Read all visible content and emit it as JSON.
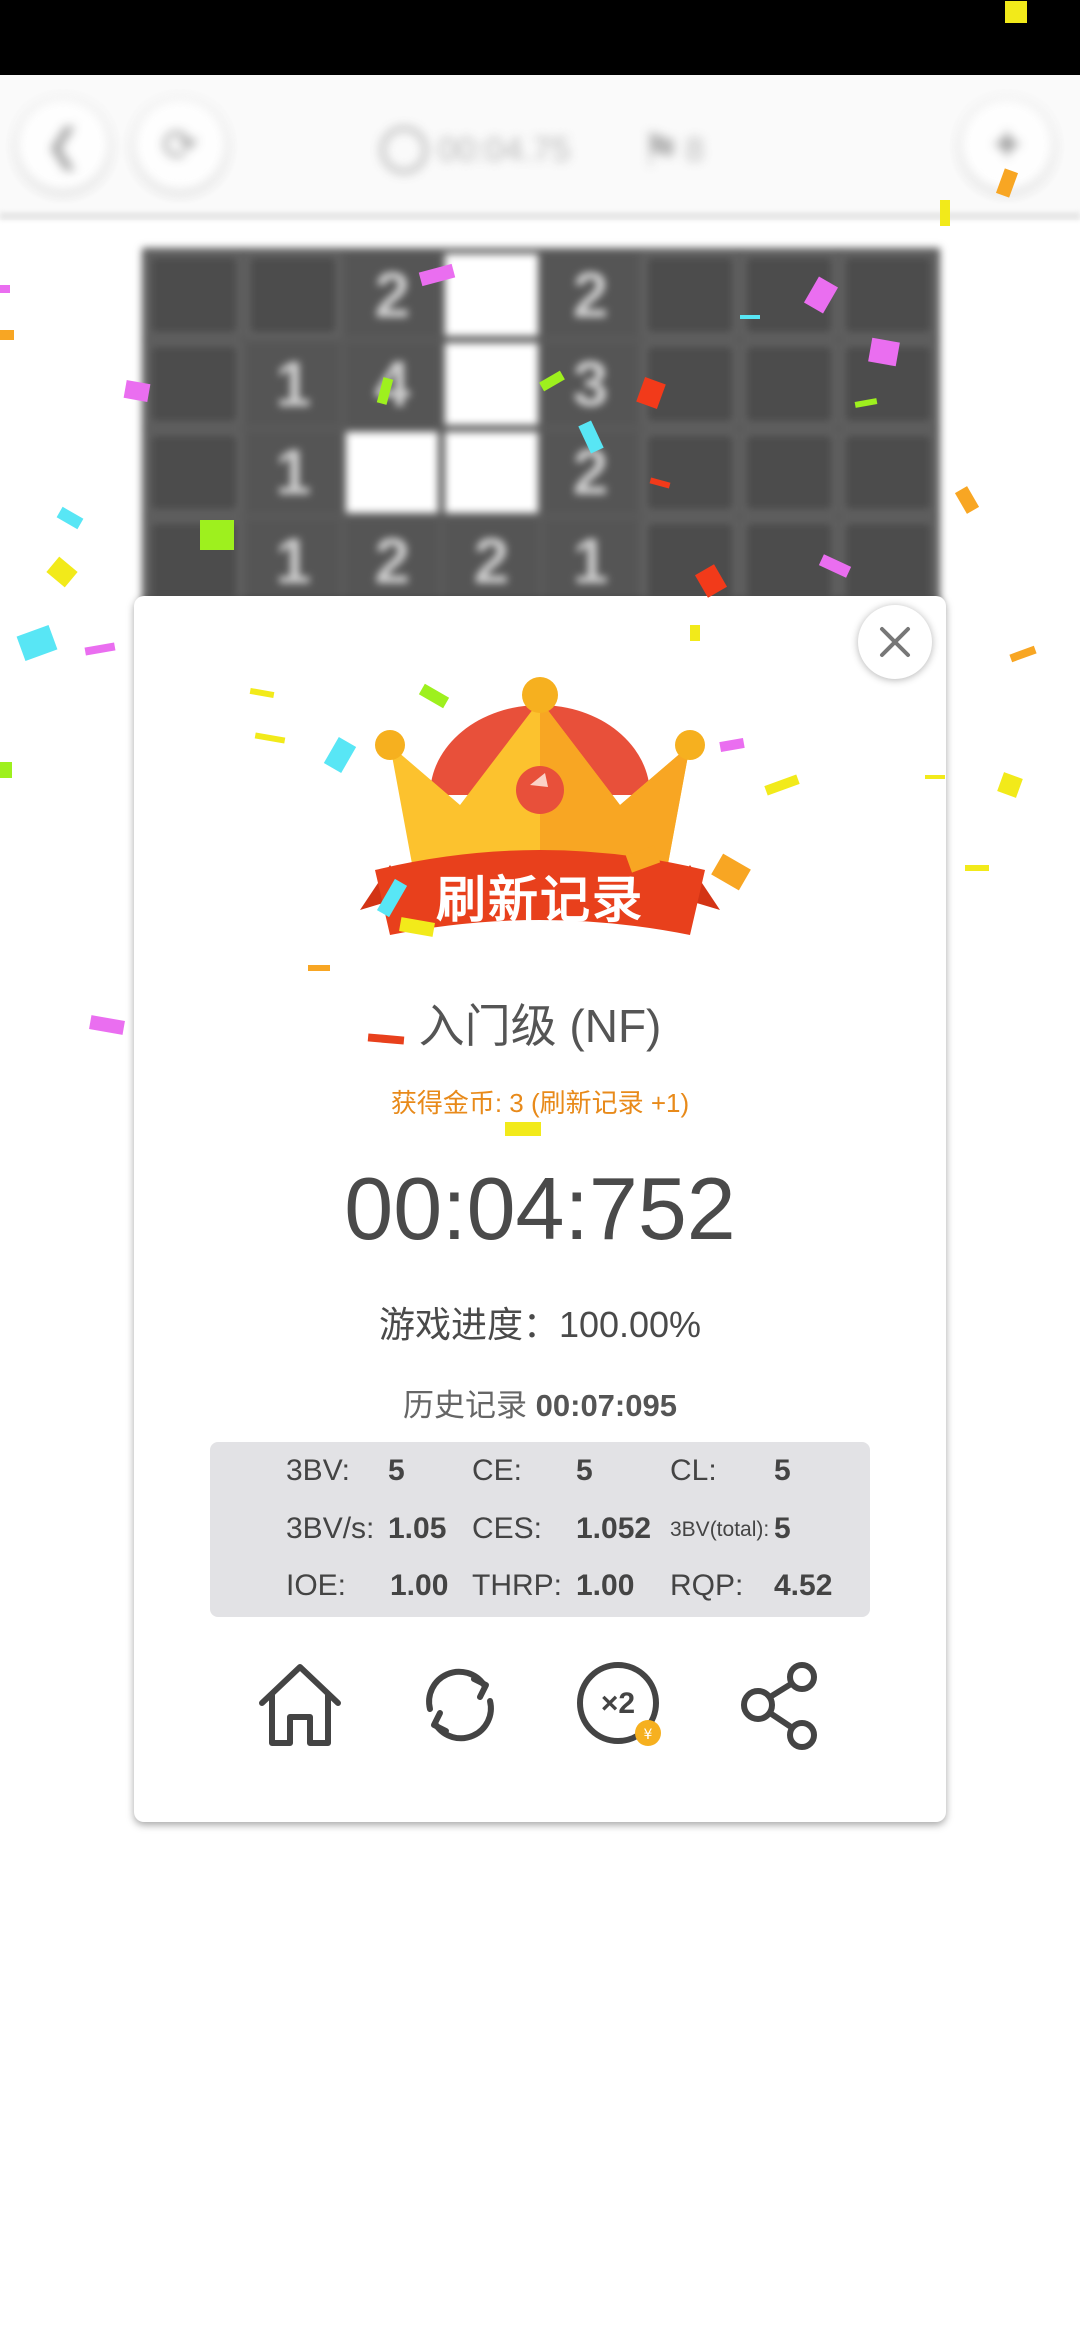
{
  "topbar": {
    "timer": "00:04.75",
    "flags": "8"
  },
  "board": {
    "cells": [
      "",
      "",
      "2",
      "#",
      "2",
      "",
      "",
      "",
      "",
      "1",
      "4",
      "#",
      "3",
      "",
      "",
      "",
      "",
      "1",
      "#",
      "#",
      "2",
      "",
      "",
      "",
      "",
      "1",
      "2",
      "2",
      "1",
      "",
      "",
      ""
    ]
  },
  "dialog": {
    "banner": "刷新记录",
    "level": "入门级 (NF)",
    "coins": "获得金币: 3 (刷新记录 +1)",
    "time": "00:04:752",
    "progress": "游戏进度：100.00%",
    "history_label": "历史记录",
    "history_value": "00:07:095",
    "stats": [
      {
        "label": "3BV:",
        "value": "5"
      },
      {
        "label": "CE:",
        "value": "5"
      },
      {
        "label": "CL:",
        "value": "5"
      },
      {
        "label": "3BV/s:",
        "value": "1.05"
      },
      {
        "label": "CES:",
        "value": "1.052"
      },
      {
        "label": "3BV(total):",
        "value": "5"
      },
      {
        "label": "IOE:",
        "value": "1.00"
      },
      {
        "label": "THRP:",
        "value": "1.00"
      },
      {
        "label": "RQP:",
        "value": "4.52"
      }
    ],
    "actions": [
      "home-icon",
      "replay-icon",
      "double-reward-icon",
      "share-icon"
    ]
  },
  "colors": {
    "banner_red": "#e8401c",
    "crown_gold": "#fcc22e",
    "coins_orange": "#e88a1a"
  }
}
